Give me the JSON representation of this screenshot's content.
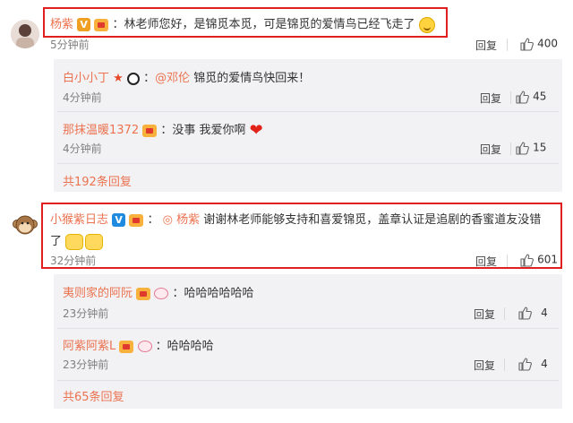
{
  "comment1": {
    "author": "杨紫",
    "text": "：林老师您好，是锦觅本觅，可是锦觅的爱情鸟已经飞走了",
    "time": "5分钟前",
    "reply_label": "回复",
    "likes": "400",
    "replies": [
      {
        "author": "白小小丁",
        "mention": "@邓伦",
        "text": "锦觅的爱情鸟快回来！",
        "time": "4分钟前",
        "reply_label": "回复",
        "likes": "45"
      },
      {
        "author": "那抹温暖1372",
        "text": "：没事 我爱你啊",
        "time": "4分钟前",
        "reply_label": "回复",
        "likes": "15"
      }
    ],
    "more_replies": "共192条回复"
  },
  "comment2": {
    "author": "小猴紫日志",
    "mention": "杨紫",
    "text_line1": "谢谢林老师能够支持和喜爱锦觅，盖章认证是追剧的香蜜道友没错",
    "text_line2": "了",
    "time": "32分钟前",
    "reply_label": "回复",
    "likes": "601",
    "replies": [
      {
        "author": "夷则家的阿阮",
        "text": "哈哈哈哈哈哈",
        "time": "23分钟前",
        "reply_label": "回复",
        "likes": "4"
      },
      {
        "author": "阿紫阿紫L",
        "text": "：哈哈哈哈",
        "time": "23分钟前",
        "reply_label": "回复",
        "likes": "4"
      }
    ],
    "more_replies": "共65条回复"
  },
  "colors": {
    "username": "#eb7350",
    "highlight_box": "#e02020",
    "reply_background": "#f2f2f5",
    "verified_gold": "#f0a020",
    "verified_blue": "#1e8ae0"
  },
  "icons": [
    "avatar",
    "verified-badge",
    "vip-crown-icon",
    "star-icon",
    "panda-icon",
    "smile-emoji",
    "heart-emoji",
    "pig-icon",
    "eye-icon",
    "thumbs-up-icon"
  ]
}
